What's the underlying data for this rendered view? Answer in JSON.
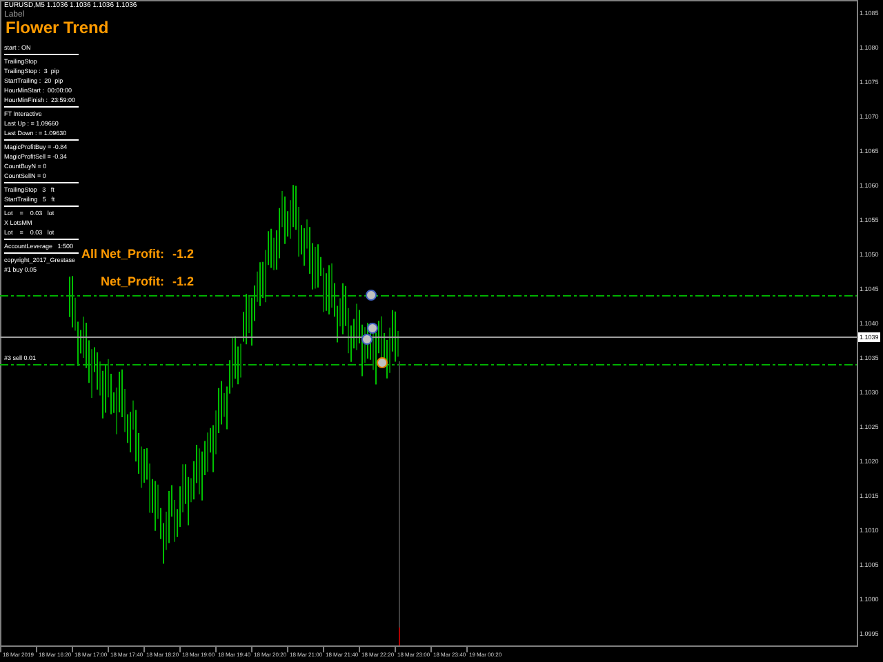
{
  "symbol_line": "EURUSD,M5 1.1036 1.1036 1.1036 1.1036",
  "panel": {
    "label": "Label",
    "title": "Flower Trend",
    "sections": [
      [
        "start : ON"
      ],
      [
        "TrailingStop",
        "TrailingStop :  3  pip",
        "StartTrailing :  20  pip",
        "HourMinStart :  00:00:00",
        "HourMinFinish :  23:59:00"
      ],
      [
        "FT Interactive",
        "Last Up : = 1.09660",
        "Last Down : = 1.09630"
      ],
      [
        "MagicProfitBuy = -0.84",
        "MagicProfitSell = -0.34",
        "CountBuyN = 0",
        "CountSellN = 0"
      ],
      [
        "TrailingStop   3   ft",
        "StartTrailing   5   ft"
      ],
      [
        "Lot    =    0.03   lot",
        "X LotsMM",
        "Lot    =    0.03   lot"
      ],
      [
        "AccountLeverage   1:500"
      ],
      [
        "copyright_2017_Grestase",
        "#1 buy 0.05"
      ]
    ]
  },
  "net_profit": [
    {
      "label": "All Net_Profit:",
      "value": "-1.2"
    },
    {
      "label": "Net_Profit:",
      "value": "-1.2"
    }
  ],
  "order_label": "#3 sell 0.01",
  "price_scale": [
    "1.1085",
    "1.1080",
    "1.1075",
    "1.1070",
    "1.1065",
    "1.1060",
    "1.1055",
    "1.1050",
    "1.1045",
    "1.1040",
    "1.1035",
    "1.1030",
    "1.1025",
    "1.1020",
    "1.1015",
    "1.1010",
    "1.1005",
    "1.1000",
    "1.0995"
  ],
  "current_price": "1.1039",
  "time_axis": [
    "18 Mar 2019",
    "18 Mar 16:20",
    "18 Mar 17:00",
    "18 Mar 17:40",
    "18 Mar 18:20",
    "18 Mar 19:00",
    "18 Mar 19:40",
    "18 Mar 20:20",
    "18 Mar 21:00",
    "18 Mar 21:40",
    "18 Mar 22:20",
    "18 Mar 23:00",
    "18 Mar 23:40",
    "19 Mar 00:20"
  ]
}
